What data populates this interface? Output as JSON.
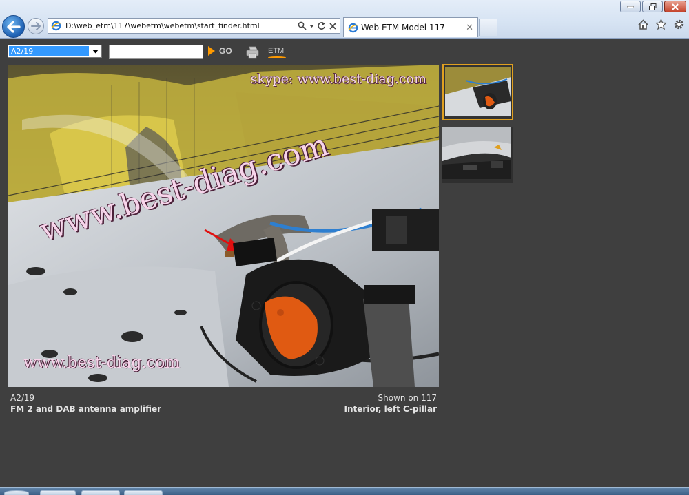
{
  "browser": {
    "address_url": "D:\\web_etm\\117\\webetm\\webetm\\start_finder.html",
    "tab_title": "Web ETM Model 117",
    "icons": [
      "back-arrow-icon",
      "forward-arrow-icon",
      "ie-logo-icon",
      "search-icon",
      "refresh-icon",
      "stop-icon",
      "home-icon",
      "favorites-star-icon",
      "tools-gear-icon"
    ]
  },
  "toolbar": {
    "component_select_value": "A2/19",
    "search_placeholder": "",
    "go_label": "GO",
    "etm_link_label": "ETM"
  },
  "photo": {
    "watermark_top": "skype: www.best-diag.com",
    "watermark_diag": "www.best-diag.com",
    "watermark_bottom": "www.best-diag.com"
  },
  "caption": {
    "component_code": "A2/19",
    "component_description": "FM 2 and DAB antenna amplifier",
    "shown_on": "Shown on 117",
    "location": "Interior, left C-pillar"
  },
  "colors": {
    "app_background": "#3f3f3f",
    "accent_orange": "#ff9a00",
    "selected_thumb_border": "#e0a020",
    "dropdown_highlight": "#3399ff"
  }
}
